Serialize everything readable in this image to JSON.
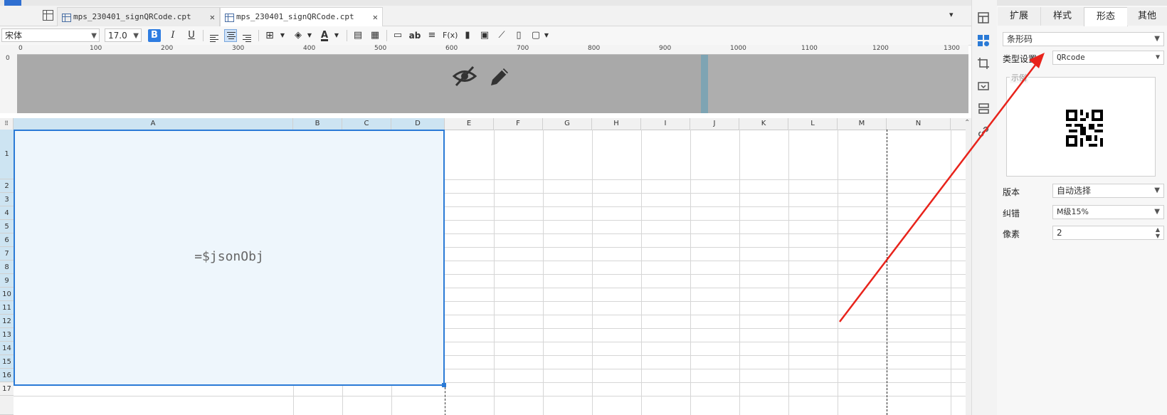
{
  "tabs": [
    {
      "label": "mps_230401_signQRCode.cpt",
      "close": "✕"
    },
    {
      "label": "mps_230401_signQRCode.cpt",
      "close": "✕"
    }
  ],
  "toolbar": {
    "font_name": "宋体",
    "font_size": "17.0",
    "bold": "B",
    "italic": "I",
    "underline": "U",
    "text_sample": "ab",
    "formula": "F(x)",
    "font_color": "A",
    "tab_menu": "▾"
  },
  "ruler": {
    "marks": [
      "0",
      "100",
      "200",
      "300",
      "400",
      "500",
      "600",
      "700",
      "800",
      "900",
      "1000",
      "1100",
      "1200",
      "1300"
    ]
  },
  "sheet": {
    "columns": [
      "A",
      "B",
      "C",
      "D",
      "E",
      "F",
      "G",
      "H",
      "I",
      "J",
      "K",
      "L",
      "M",
      "N"
    ],
    "rows": [
      "1",
      "2",
      "3",
      "4",
      "5",
      "6",
      "7",
      "8",
      "9",
      "10",
      "11",
      "12",
      "13",
      "14",
      "15",
      "16",
      "17"
    ],
    "merged_cell_value": "=$jsonObj"
  },
  "panel": {
    "tabs": [
      "扩展",
      "样式",
      "形态",
      "其他"
    ],
    "active_tab": "形态",
    "type_select": "条形码",
    "type_setting_label": "类型设置",
    "type_setting_value": "QRcode",
    "preview_label": "示例",
    "version_label": "版本",
    "version_value": "自动选择",
    "error_label": "纠错",
    "error_value": "M级15%",
    "pixel_label": "像素",
    "pixel_value": "2"
  },
  "colors": {
    "accent": "#2a7ad6",
    "selected_cell_bg": "#eef6fc",
    "band_gray": "#aeaeae",
    "annotation_arrow": "#e8231b"
  }
}
